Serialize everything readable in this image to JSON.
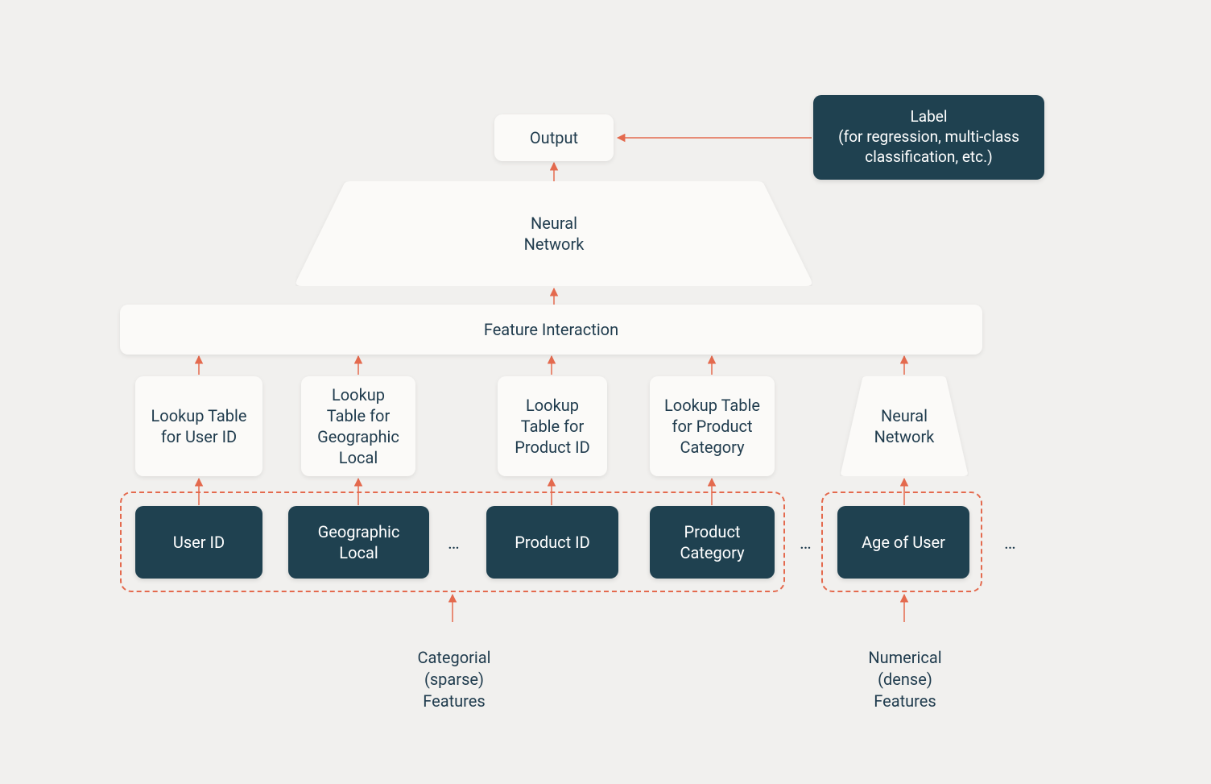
{
  "blocks": {
    "output": "Output",
    "label_box": "Label\n(for regression, multi-class\nclassification, etc.)",
    "neural_network_top": "Neural\nNetwork",
    "feature_interaction": "Feature Interaction",
    "lookup_user_id": "Lookup Table\nfor User ID",
    "lookup_geo": "Lookup\nTable for\nGeographic\nLocal",
    "lookup_product_id": "Lookup\nTable for\nProduct ID",
    "lookup_product_cat": "Lookup Table\nfor Product\nCategory",
    "neural_network_right": "Neural\nNetwork",
    "feat_user_id": "User ID",
    "feat_geo": "Geographic\nLocal",
    "feat_product_id": "Product ID",
    "feat_product_cat": "Product\nCategory",
    "feat_age": "Age of User"
  },
  "ellipsis": "…",
  "captions": {
    "categorical": "Categorial\n(sparse)\nFeatures",
    "numerical": "Numerical\n(dense)\nFeatures"
  }
}
